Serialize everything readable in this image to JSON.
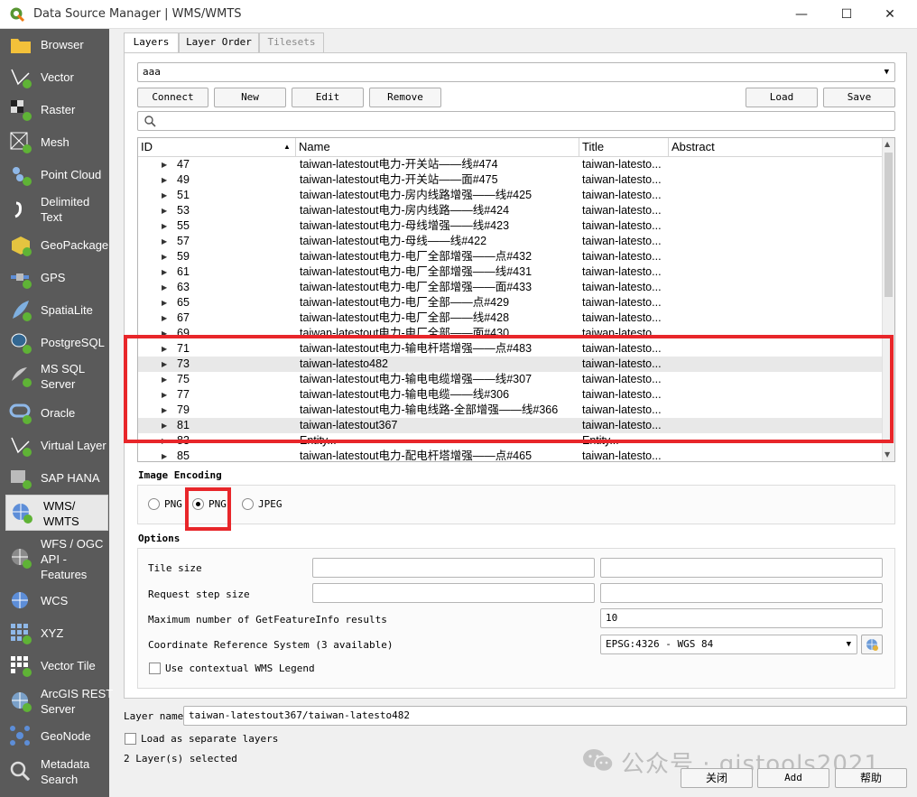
{
  "window": {
    "title": "Data Source Manager | WMS/WMTS",
    "minimize": "—",
    "maximize": "☐",
    "close": "✕"
  },
  "sidebar": {
    "items": [
      {
        "label": "Browser"
      },
      {
        "label": "Vector"
      },
      {
        "label": "Raster"
      },
      {
        "label": "Mesh"
      },
      {
        "label": "Point Cloud"
      },
      {
        "label": "Delimited\nText"
      },
      {
        "label": "GeoPackage"
      },
      {
        "label": "GPS"
      },
      {
        "label": "SpatiaLite"
      },
      {
        "label": "PostgreSQL"
      },
      {
        "label": "MS SQL\nServer"
      },
      {
        "label": "Oracle"
      },
      {
        "label": "Virtual Layer"
      },
      {
        "label": "SAP HANA"
      },
      {
        "label": "WMS/\nWMTS"
      },
      {
        "label": "WFS / OGC\nAPI -\nFeatures"
      },
      {
        "label": "WCS"
      },
      {
        "label": "XYZ"
      },
      {
        "label": "Vector Tile"
      },
      {
        "label": "ArcGIS REST\nServer"
      },
      {
        "label": "GeoNode"
      },
      {
        "label": "Metadata\nSearch"
      }
    ]
  },
  "tabs": [
    "Layers",
    "Layer Order",
    "Tilesets"
  ],
  "connection": {
    "value": "aaa"
  },
  "buttons": {
    "connect": "Connect",
    "new": "New",
    "edit": "Edit",
    "remove": "Remove",
    "load": "Load",
    "save": "Save"
  },
  "table": {
    "headers": [
      "ID",
      "Name",
      "Title",
      "Abstract"
    ],
    "rows": [
      {
        "id": "47",
        "name": "taiwan-latestout电力-开关站——线#474",
        "title": "taiwan-latesto..."
      },
      {
        "id": "49",
        "name": "taiwan-latestout电力-开关站——面#475",
        "title": "taiwan-latesto..."
      },
      {
        "id": "51",
        "name": "taiwan-latestout电力-房内线路增强——线#425",
        "title": "taiwan-latesto..."
      },
      {
        "id": "53",
        "name": "taiwan-latestout电力-房内线路——线#424",
        "title": "taiwan-latesto..."
      },
      {
        "id": "55",
        "name": "taiwan-latestout电力-母线增强——线#423",
        "title": "taiwan-latesto..."
      },
      {
        "id": "57",
        "name": "taiwan-latestout电力-母线——线#422",
        "title": "taiwan-latesto..."
      },
      {
        "id": "59",
        "name": "taiwan-latestout电力-电厂全部增强——点#432",
        "title": "taiwan-latesto..."
      },
      {
        "id": "61",
        "name": "taiwan-latestout电力-电厂全部增强——线#431",
        "title": "taiwan-latesto..."
      },
      {
        "id": "63",
        "name": "taiwan-latestout电力-电厂全部增强——面#433",
        "title": "taiwan-latesto..."
      },
      {
        "id": "65",
        "name": "taiwan-latestout电力-电厂全部——点#429",
        "title": "taiwan-latesto..."
      },
      {
        "id": "67",
        "name": "taiwan-latestout电力-电厂全部——线#428",
        "title": "taiwan-latesto..."
      },
      {
        "id": "69",
        "name": "taiwan-latestout电力-电厂全部——面#430",
        "title": "taiwan-latesto..."
      },
      {
        "id": "71",
        "name": "taiwan-latestout电力-输电杆塔增强——点#483",
        "title": "taiwan-latesto..."
      },
      {
        "id": "73",
        "name": "taiwan-latesto482",
        "title": "taiwan-latesto..."
      },
      {
        "id": "75",
        "name": "taiwan-latestout电力-输电电缆增强——线#307",
        "title": "taiwan-latesto..."
      },
      {
        "id": "77",
        "name": "taiwan-latestout电力-输电电缆——线#306",
        "title": "taiwan-latesto..."
      },
      {
        "id": "79",
        "name": "taiwan-latestout电力-输电线路-全部增强——线#366",
        "title": "taiwan-latesto..."
      },
      {
        "id": "81",
        "name": "taiwan-latestout367",
        "title": "taiwan-latesto..."
      },
      {
        "id": "83",
        "name": "Entity...",
        "title": "Entity..."
      },
      {
        "id": "85",
        "name": "taiwan-latestout电力-配电杆塔增强——点#465",
        "title": "taiwan-latesto..."
      }
    ]
  },
  "image_encoding": {
    "title": "Image Encoding",
    "options": [
      "PNG",
      "PNG",
      "JPEG"
    ],
    "selected_index": 1
  },
  "options": {
    "title": "Options",
    "tile_size_label": "Tile size",
    "request_step_label": "Request step size",
    "max_feature_label": "Maximum number of GetFeatureInfo results",
    "max_feature_value": "10",
    "crs_label": "Coordinate Reference System (3 available)",
    "crs_value": "EPSG:4326 - WGS 84",
    "contextual_legend_label": "Use contextual WMS Legend"
  },
  "layer_name": {
    "label": "Layer name",
    "value": "taiwan-latestout367/taiwan-latesto482"
  },
  "separate_layers_label": "Load as separate layers",
  "status": "2 Layer(s) selected",
  "footer_buttons": {
    "close": "关闭",
    "add": "Add",
    "help": "帮助"
  },
  "watermark": "公众号 · gistools2021",
  "colors": {
    "highlight": "#e8262a",
    "sidebar_bg": "#5a5a5a"
  }
}
